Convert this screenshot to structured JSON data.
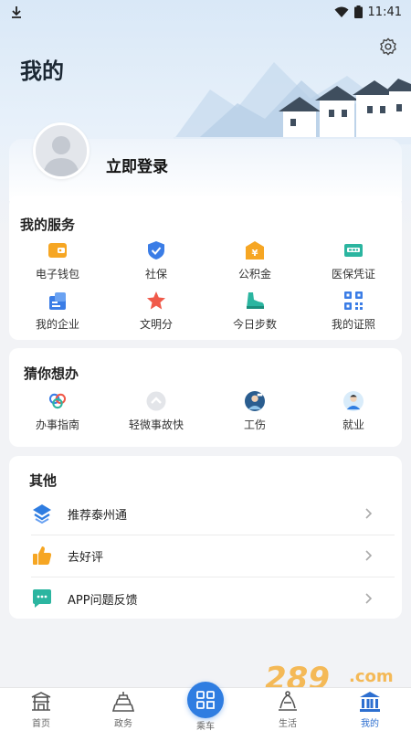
{
  "status": {
    "time": "11:41"
  },
  "page_title": "我的",
  "login": {
    "label": "立即登录"
  },
  "services": {
    "title": "我的服务",
    "items": [
      {
        "label": "电子钱包",
        "icon": "wallet-icon"
      },
      {
        "label": "社保",
        "icon": "shield-check-icon"
      },
      {
        "label": "公积金",
        "icon": "fund-icon"
      },
      {
        "label": "医保凭证",
        "icon": "medical-card-icon"
      },
      {
        "label": "我的企业",
        "icon": "enterprise-icon"
      },
      {
        "label": "文明分",
        "icon": "star-badge-icon"
      },
      {
        "label": "今日步数",
        "icon": "shoe-icon"
      },
      {
        "label": "我的证照",
        "icon": "qr-code-icon"
      }
    ]
  },
  "guess": {
    "title": "猜你想办",
    "items": [
      {
        "label": "办事指南",
        "icon": "guide-rings-icon"
      },
      {
        "label": "轻微事故快",
        "icon": "car-accident-icon"
      },
      {
        "label": "工伤",
        "icon": "injury-avatar-icon"
      },
      {
        "label": "就业",
        "icon": "job-avatar-icon"
      }
    ]
  },
  "other": {
    "title": "其他",
    "items": [
      {
        "label": "推荐泰州通",
        "icon": "recommend-logo-icon"
      },
      {
        "label": "去好评",
        "icon": "thumbs-up-icon"
      },
      {
        "label": "APP问题反馈",
        "icon": "feedback-chat-icon"
      }
    ]
  },
  "tabs": [
    {
      "label": "首页",
      "icon": "home-gate-icon"
    },
    {
      "label": "政务",
      "icon": "tower-icon"
    },
    {
      "label": "乘车",
      "icon": "bus-code-icon"
    },
    {
      "label": "生活",
      "icon": "life-icon"
    },
    {
      "label": "我的",
      "icon": "museum-icon",
      "active": true
    }
  ],
  "colors": {
    "accent": "#2f7de1",
    "title": "#1b2733",
    "background": "#f2f3f6"
  }
}
